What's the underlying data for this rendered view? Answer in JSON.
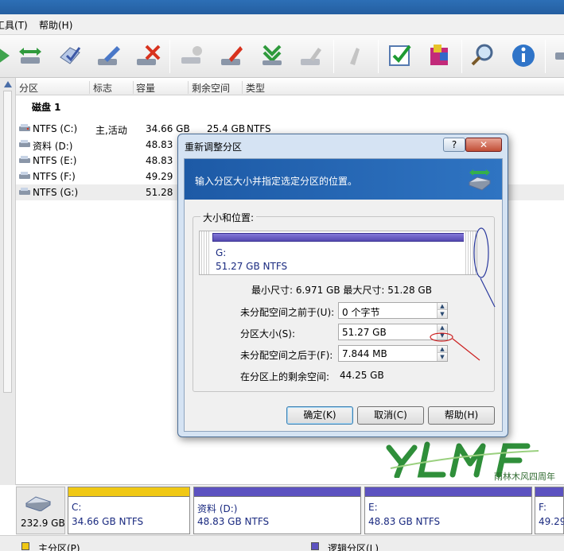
{
  "menubar": {
    "items": [
      "工具(T)",
      "帮助(H)"
    ]
  },
  "toolbar": {
    "buttons": [
      "back-icon",
      "move-icon",
      "check-disk-icon",
      "edit-icon",
      "delete-icon",
      "format-icon",
      "resize-icon",
      "merge-icon",
      "wipe-icon",
      "clean-icon",
      "apply-icon",
      "install-icon",
      "search-icon",
      "info-icon",
      "forward-icon"
    ]
  },
  "list": {
    "columns": [
      "分区",
      "标志",
      "容量",
      "剩余空间",
      "类型"
    ],
    "disk_label": "磁盘 1",
    "rows": [
      {
        "name": "NTFS (C:)",
        "flag": "主,活动",
        "capacity": "34.66 GB",
        "free": "25.4 GB",
        "type": "NTFS"
      },
      {
        "name": "资料 (D:)",
        "flag": "",
        "capacity": "48.83",
        "free": "",
        "type": ""
      },
      {
        "name": "NTFS (E:)",
        "flag": "",
        "capacity": "48.83",
        "free": "",
        "type": ""
      },
      {
        "name": "NTFS (F:)",
        "flag": "",
        "capacity": "49.29",
        "free": "",
        "type": ""
      },
      {
        "name": "NTFS (G:)",
        "flag": "",
        "capacity": "51.28",
        "free": "",
        "type": ""
      }
    ]
  },
  "dialog": {
    "title": "重新调整分区",
    "help_btn": "?",
    "close_btn": "✕",
    "banner_text": "输入分区大小并指定选定分区的位置。",
    "group_title": "大小和位置:",
    "partition_name": "G:",
    "partition_size": "51.27 GB  NTFS",
    "minmax": "最小尺寸: 6.971 GB    最大尺寸: 51.28 GB",
    "fields": {
      "before_label": "未分配空间之前于(U):",
      "before_value": "0 个字节",
      "size_label": "分区大小(S):",
      "size_value": "51.27 GB",
      "after_label": "未分配空间之后于(F):",
      "after_value": "7.844 MB",
      "remaining_label": "在分区上的剩余空间:",
      "remaining_value": "44.25 GB"
    },
    "buttons": {
      "ok": "确定(K)",
      "cancel": "取消(C)",
      "help": "帮助(H)"
    }
  },
  "diskmap": {
    "disk_size": "232.9 GB",
    "partitions": [
      {
        "name": "C:",
        "size": "34.66 GB  NTFS",
        "color": "#f0c814"
      },
      {
        "name": "资料 (D:)",
        "size": "48.83 GB  NTFS",
        "color": "#5c52c0"
      },
      {
        "name": "E:",
        "size": "48.83 GB  NTFS",
        "color": "#5c52c0"
      },
      {
        "name": "F:",
        "size": "49.29",
        "color": "#5c52c0"
      }
    ]
  },
  "legend": {
    "primary": "主分区(P)",
    "logical": "逻辑分区(L)"
  },
  "watermark": {
    "logo": "YLMF",
    "caption": "雨林木风四周年"
  }
}
